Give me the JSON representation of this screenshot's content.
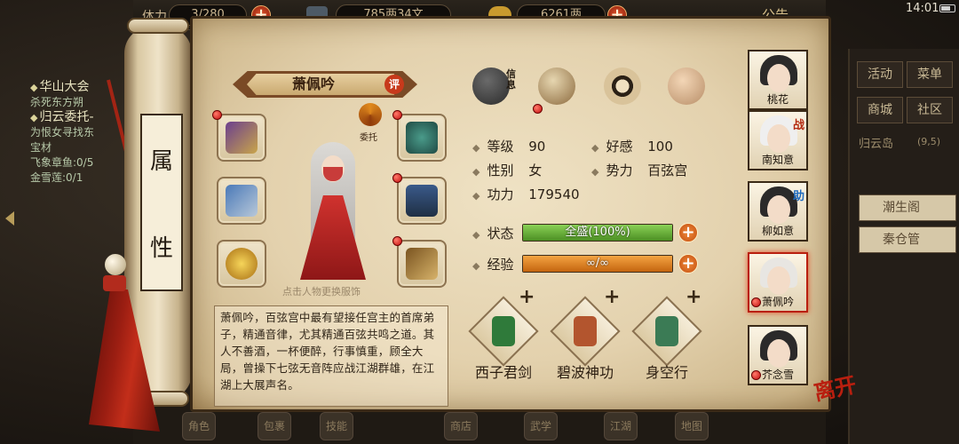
{
  "topbar": {
    "stamina": "3/280",
    "stamina_prefix": "体力",
    "silver": "785两34文",
    "gold": "6261两",
    "notice": "公告",
    "time": "14:01"
  },
  "quests": [
    {
      "title": "华山大会",
      "detail": "杀死东方朔"
    },
    {
      "title": "归云委托-",
      "detail": "为恨女寻找东\n宝材\n飞象章鱼:0/5\n金雪莲:0/1"
    }
  ],
  "side_menu": {
    "buttons": [
      "活动",
      "菜单",
      "商城",
      "社区"
    ],
    "location": "归云岛",
    "location_coords": "(9,5)",
    "rows": [
      "潮生阁",
      "秦仓管"
    ]
  },
  "bottom_nav": [
    "角色",
    "包裹",
    "技能",
    "商店",
    "武学",
    "江湖",
    "地图"
  ],
  "scroll_label": [
    "属",
    "性"
  ],
  "character": {
    "name": "萧佩吟",
    "rate_label": "评",
    "entrust_label": "委托",
    "hint": "点击人物更换服饰",
    "description": "萧佩吟，百弦宫中最有望接任宫主的首席弟子，精通音律，尤其精通百弦共鸣之道。其人不善酒，一杯便醉，行事慎重，顾全大局，曾操下七弦无音阵应战江湖群雄，在江湖上大展声名。"
  },
  "tabs": {
    "info_label": "信息"
  },
  "stats": {
    "level_label": "等级",
    "level": "90",
    "favor_label": "好感",
    "favor": "100",
    "gender_label": "性别",
    "gender": "女",
    "faction_label": "势力",
    "faction": "百弦宫",
    "power_label": "功力",
    "power": "179540",
    "status_label": "状态",
    "status_value": "全盛(100%)",
    "status_fill": 1.0,
    "exp_label": "经验",
    "exp_value": "∞/∞",
    "exp_fill": 1.0
  },
  "skills": [
    {
      "name": "西子君剑",
      "color": "#2f7a3a"
    },
    {
      "name": "碧波神功",
      "color": "#b3552e"
    },
    {
      "name": "身空行",
      "color": "#3b7b55"
    }
  ],
  "companions": [
    {
      "name": "桃花",
      "badge": ""
    },
    {
      "name": "南知意",
      "badge": "战"
    },
    {
      "name": "柳如意",
      "badge": "助"
    },
    {
      "name": "萧佩吟",
      "badge": ""
    },
    {
      "name": "芥念雪",
      "badge": ""
    }
  ],
  "leave_label": "离开",
  "colors": {
    "status_bar": "#6cb33c",
    "exp_bar": "#e88a2a",
    "alert_dot": "#d01212",
    "accent_red": "#b91f0f"
  }
}
